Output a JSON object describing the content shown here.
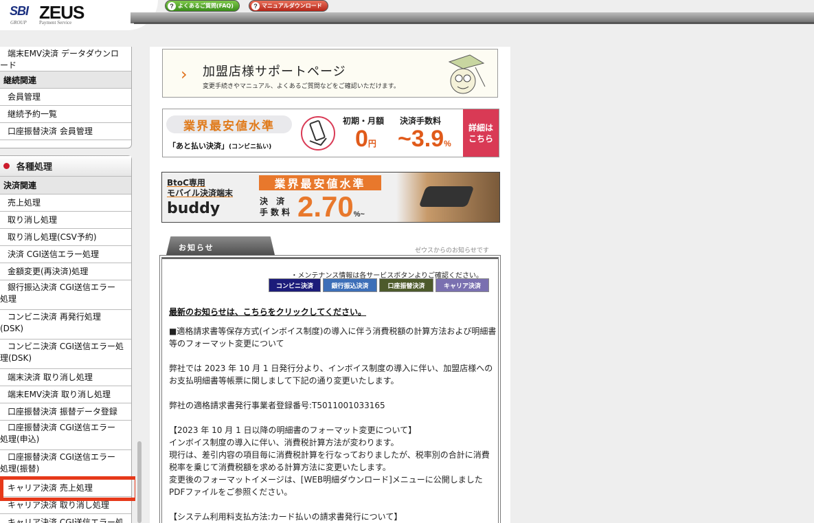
{
  "header": {
    "logo_sbi": "SBI",
    "logo_group": "GROUP",
    "logo_zeus": "ZEUS",
    "logo_payment": "Payment Service",
    "faq_label": "よくあるご質問(FAQ)",
    "manual_label": "マニュアルダウンロード"
  },
  "sidebar": {
    "box1": [
      {
        "type": "item",
        "label": "端末EMV決済 データダウンロ\nード"
      },
      {
        "type": "cat",
        "label": "継続関連"
      },
      {
        "type": "item",
        "label": "会員管理"
      },
      {
        "type": "item",
        "label": "継続予約一覧"
      },
      {
        "type": "item",
        "label": "口座振替決済 会員管理"
      }
    ],
    "box2_title": "各種処理",
    "box2": [
      {
        "type": "cat",
        "label": "決済関連"
      },
      {
        "type": "item",
        "label": "売上処理"
      },
      {
        "type": "item",
        "label": "取り消し処理"
      },
      {
        "type": "item",
        "label": "取り消し処理(CSV予約)"
      },
      {
        "type": "item",
        "label": "決済 CGI送信エラー処理"
      },
      {
        "type": "item",
        "label": "金額変更(再決済)処理"
      },
      {
        "type": "item",
        "label": "銀行振込決済 CGI送信エラー\n処理"
      },
      {
        "type": "item",
        "label": "コンビニ決済 再発行処理\n(DSK)"
      },
      {
        "type": "item",
        "label": "コンビニ決済 CGI送信エラー処\n理(DSK)"
      },
      {
        "type": "item",
        "label": "端末決済 取り消し処理"
      },
      {
        "type": "item",
        "label": "端末EMV決済 取り消し処理"
      },
      {
        "type": "item",
        "label": "口座振替決済 振替データ登録"
      },
      {
        "type": "item",
        "label": "口座振替決済 CGI送信エラー\n処理(申込)"
      },
      {
        "type": "item",
        "label": "口座振替決済 CGI送信エラー\n処理(振替)"
      },
      {
        "type": "item",
        "label": "キャリア決済 売上処理"
      },
      {
        "type": "item",
        "label": "キャリア決済 取り消し処理"
      },
      {
        "type": "item",
        "label": "キャリア決済 CGI送信エラー処"
      }
    ]
  },
  "banners": {
    "support_title": "加盟店様サポートページ",
    "support_sub": "変更手続きやマニュアル、よくあるご質問などをご確認いただけます。",
    "atobarai_pill": "業界最安値水準",
    "atobarai_name": "「あと払い決済」",
    "atobarai_small": "(コンビニ払い)",
    "initial_label": "初期・月額",
    "fee_label": "決済手数料",
    "initial_value": "0",
    "initial_unit": "円",
    "fee_value": "~3.9",
    "fee_unit": "%",
    "detail_label": "詳細は\nこちら",
    "buddy_line1": "BtoC専用",
    "buddy_line2": "モバイル決済端末",
    "buddy_name": "buddy",
    "buddy_pill": "業界最安値水準",
    "buddy_fee_label": "決 済\n手数料",
    "buddy_rate": "2.70",
    "buddy_rate_unit": "%~"
  },
  "news": {
    "tab_label": "お知らせ",
    "tab_sub": "ゼウスからのお知らせです",
    "maint_info": "・メンテナンス情報は各サービスボタンよりご確認ください。",
    "services": [
      "コンビニ決済",
      "銀行振込決済",
      "口座振替決済",
      "キャリア決済"
    ],
    "latest_link": "最新のお知らせは、こちらをクリックしてください。",
    "paragraphs": [
      "■適格請求書等保存方式(インボイス制度)の導入に伴う消費税額の計算方法および明細書等のフォーマット変更について",
      "弊社では 2023 年 10 月 1 日発行分より、インボイス制度の導入に伴い、加盟店様へのお支払明細書等帳票に関しまして下記の通り変更いたします。",
      "弊社の適格請求書発行事業者登録番号:T5011001033165",
      "【2023 年 10 月 1 日以降の明細書のフォーマット変更について】\nインボイス制度の導入に伴い、消費税計算方法が変わります。\n現行は、差引内容の項目毎に消費税計算を行なっておりましたが、税率別の合計に消費税率を乗じて消費税額を求める計算方法に変更いたします。\n変更後のフォーマットイメージは、[WEB明細ダウンロード]メニューに公開しましたPDFファイルをご参照ください。",
      "【システム利用料支払方法:カード払いの請求書発行について】"
    ]
  },
  "colors": {
    "accent_orange": "#e05a1a",
    "highlight_red": "#e6391a",
    "bullet_red": "#cc1b2c"
  }
}
